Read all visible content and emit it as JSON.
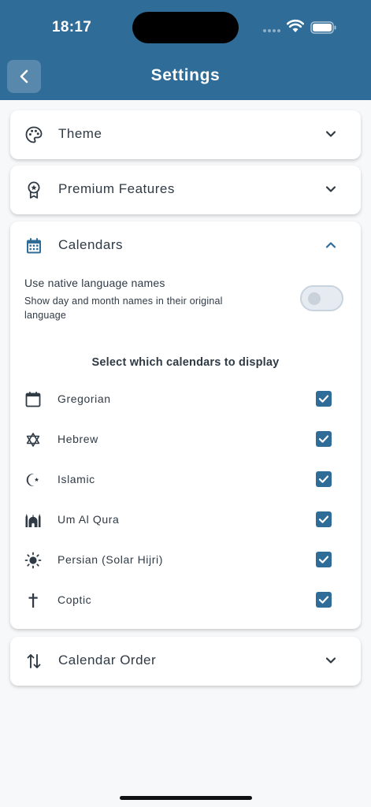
{
  "status_bar": {
    "time": "18:17"
  },
  "header": {
    "title": "Settings"
  },
  "sections": {
    "theme": {
      "label": "Theme"
    },
    "premium": {
      "label": "Premium Features"
    },
    "calendars": {
      "label": "Calendars",
      "native_names_title": "Use native language names",
      "native_names_subtitle": "Show day and month names in their original language",
      "native_names_enabled": false,
      "select_label": "Select which calendars to display",
      "items": [
        {
          "label": "Gregorian",
          "icon": "calendar-icon",
          "checked": true
        },
        {
          "label": "Hebrew",
          "icon": "star-of-david-icon",
          "checked": true
        },
        {
          "label": "Islamic",
          "icon": "crescent-star-icon",
          "checked": true
        },
        {
          "label": "Um Al Qura",
          "icon": "mosque-icon",
          "checked": true
        },
        {
          "label": "Persian (Solar Hijri)",
          "icon": "sun-icon",
          "checked": true
        },
        {
          "label": "Coptic",
          "icon": "cross-icon",
          "checked": true
        }
      ]
    },
    "order": {
      "label": "Calendar Order"
    }
  },
  "colors": {
    "primary": "#2f6c98",
    "text": "#2f3a45",
    "background": "#f7f8fa"
  }
}
